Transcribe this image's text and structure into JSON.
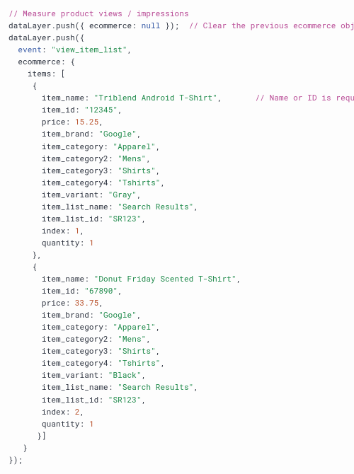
{
  "code_comment_top": "// Measure product views / impressions",
  "code_comment_clear": "// Clear the previous ecommerce object.",
  "code_comment_name_required": "// Name or ID is required.",
  "event_value": "\"view_item_list\"",
  "null_keyword": "null",
  "item1": {
    "name": "\"Triblend Android T-Shirt\"",
    "id": "\"12345\"",
    "price": "15.25",
    "brand": "\"Google\"",
    "cat1": "\"Apparel\"",
    "cat2": "\"Mens\"",
    "cat3": "\"Shirts\"",
    "cat4": "\"Tshirts\"",
    "variant": "\"Gray\"",
    "list_name": "\"Search Results\"",
    "list_id": "\"SR123\"",
    "index": "1",
    "quantity": "1"
  },
  "item2": {
    "name": "\"Donut Friday Scented T-Shirt\"",
    "id": "\"67890\"",
    "price": "33.75",
    "brand": "\"Google\"",
    "cat1": "\"Apparel\"",
    "cat2": "\"Mens\"",
    "cat3": "\"Shirts\"",
    "cat4": "\"Tshirts\"",
    "variant": "\"Black\"",
    "list_name": "\"Search Results\"",
    "list_id": "\"SR123\"",
    "index": "2",
    "quantity": "1"
  },
  "labels": {
    "dataLayer": "dataLayer",
    "push": "push",
    "ecommerce": "ecommerce",
    "event": "event",
    "items": "items",
    "item_name": "item_name",
    "item_id": "item_id",
    "price": "price",
    "item_brand": "item_brand",
    "item_category": "item_category",
    "item_category2": "item_category2",
    "item_category3": "item_category3",
    "item_category4": "item_category4",
    "item_variant": "item_variant",
    "item_list_name": "item_list_name",
    "item_list_id": "item_list_id",
    "index": "index",
    "quantity": "quantity"
  }
}
